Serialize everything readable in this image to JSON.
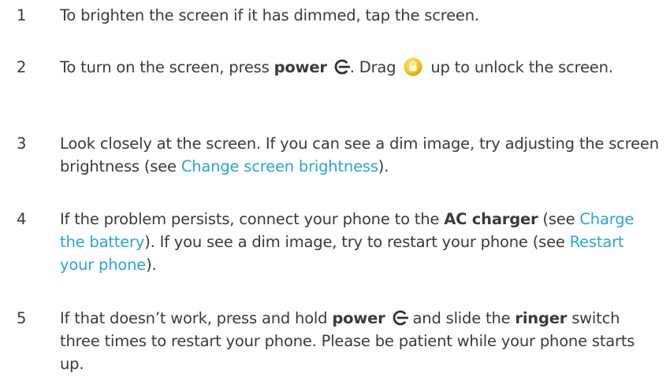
{
  "steps": [
    {
      "num": "1",
      "text": "To brighten the screen if it has dimmed, tap the screen."
    },
    {
      "num": "2",
      "t1": "To turn on the screen, press ",
      "b1": "power",
      "t2": ". Drag ",
      "t3": " up to unlock the screen.",
      "icons": [
        "power-icon",
        "unlock-icon"
      ]
    },
    {
      "num": "3",
      "t1": "Look closely at the screen. If you can see a dim image, try adjusting the screen brightness (see ",
      "link1": "Change screen brightness",
      "t2": ")."
    },
    {
      "num": "4",
      "t1": "If the problem persists, connect your phone to the ",
      "b1": "AC charger",
      "t2": " (see ",
      "link1": "Charge the battery",
      "t3": "). If you see a dim image, try to restart your phone (see ",
      "link2": "Restart your phone",
      "t4": ")."
    },
    {
      "num": "5",
      "t1": "If that doesn’t work, press and hold ",
      "b1": "power",
      "t2": " and slide the ",
      "b2": "ringer",
      "t3": " switch three times to restart your phone. Please be patient while your phone starts up.",
      "icons": [
        "power-icon"
      ]
    }
  ],
  "colors": {
    "text": "#3a3a3a",
    "link": "#2aa4d8",
    "lock_icon": "#f5c518"
  }
}
